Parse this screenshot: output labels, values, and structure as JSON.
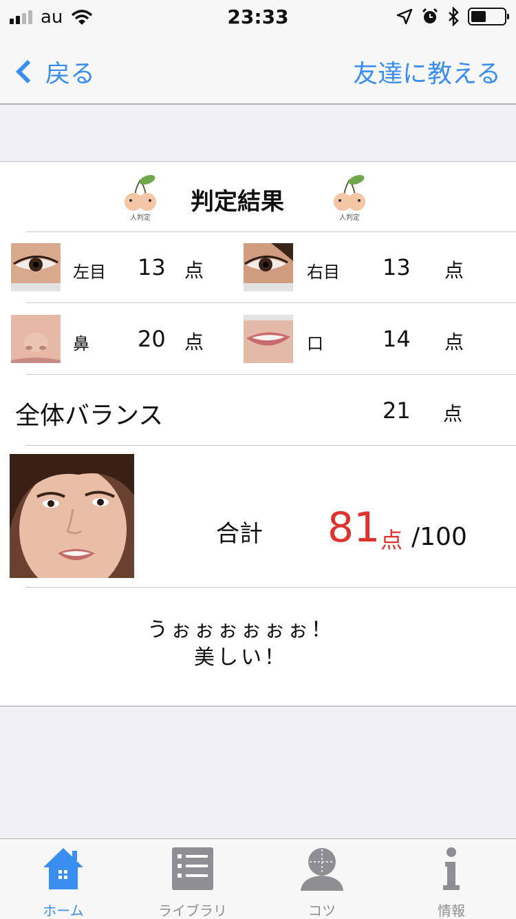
{
  "status_bar": {
    "carrier": "au",
    "time": "23:33",
    "battery_percent": 45
  },
  "nav": {
    "back_label": "戻る",
    "share_label": "友達に教える"
  },
  "result": {
    "title": "判定結果",
    "logo_text": "人判定",
    "parts": [
      {
        "label": "左目",
        "score": "13",
        "unit": "点"
      },
      {
        "label": "右目",
        "score": "13",
        "unit": "点"
      },
      {
        "label": "鼻",
        "score": "20",
        "unit": "点"
      },
      {
        "label": "口",
        "score": "14",
        "unit": "点"
      }
    ],
    "balance": {
      "label": "全体バランス",
      "score": "21",
      "unit": "点"
    },
    "total": {
      "label": "合計",
      "score": "81",
      "unit": "点",
      "max": "/100"
    },
    "comment_line1": "うぉぉぉぉぉぉ！",
    "comment_line2": "美しい！"
  },
  "tabs": [
    {
      "label": "ホーム",
      "icon": "home-icon",
      "active": true
    },
    {
      "label": "ライブラリ",
      "icon": "list-icon",
      "active": false
    },
    {
      "label": "コツ",
      "icon": "face-guide-icon",
      "active": false
    },
    {
      "label": "情報",
      "icon": "info-icon",
      "active": false
    }
  ],
  "colors": {
    "accent": "#3a8ef0",
    "score_red": "#e0322c"
  }
}
